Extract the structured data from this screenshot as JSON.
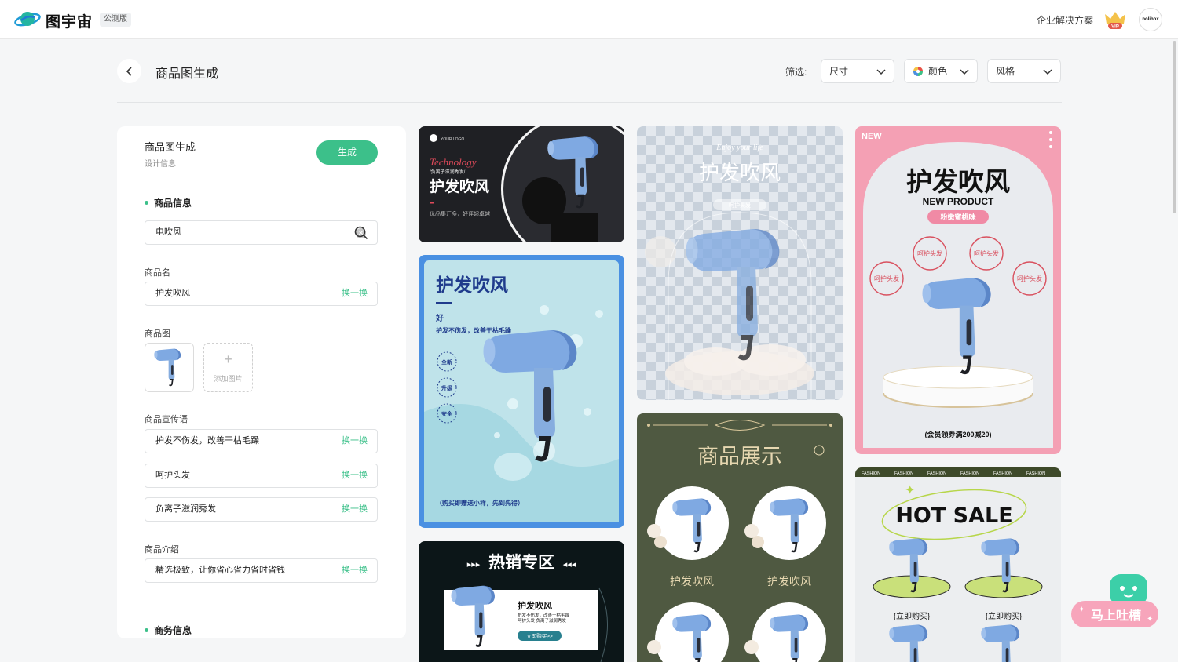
{
  "brand": {
    "name": "图宇宙",
    "badge": "公测版"
  },
  "topbar": {
    "enterprise": "企业解决方案",
    "vip": "VIP",
    "avatar_text": "nolibox"
  },
  "header": {
    "title": "商品图生成",
    "filter_label": "筛选:",
    "filters": [
      "尺寸",
      "颜色",
      "风格"
    ]
  },
  "panel": {
    "title": "商品图生成",
    "subtitle": "设计信息",
    "generate": "生成",
    "product_info": "商品信息",
    "search_value": "电吹风",
    "name_label": "商品名",
    "name_value": "护发吹风",
    "image_label": "商品图",
    "add_image": "添加图片",
    "slogan_label": "商品宣传语",
    "slogans": [
      "护发不伤发，改善干枯毛躁",
      "呵护头发",
      "负离子滋润秀发"
    ],
    "intro_label": "商品介绍",
    "intro_value": "精选极致，让你省心省力省时省钱",
    "swap": "换一换",
    "business_info": "商务信息"
  },
  "templates": {
    "t1": {
      "logo": "YOUR LOGO",
      "script": "Technology",
      "tag": "/负离子滋润秀发/",
      "title": "护发吹风",
      "caption": "优品集汇多，好评超卓越"
    },
    "t2": {
      "title": "护发吹风",
      "good": "好",
      "sub": "护发不伤发，改善干枯毛躁",
      "badges": [
        "全新",
        "升级",
        "安全"
      ],
      "footer": "（购买即赠送小样，先到先得）"
    },
    "t3": {
      "script": "Enjoy your life",
      "title": "护发吹风",
      "pill": "呵护头发"
    },
    "t4": {
      "new": "NEW",
      "title": "护发吹风",
      "sub": "NEW PRODUCT",
      "pill": "粉嫩蜜桃味",
      "stamps": [
        "呵护头发",
        "呵护头发",
        "呵护头发",
        "呵护头发"
      ],
      "footer": "(会员领券满200减20)"
    },
    "t5": {
      "title": "商品展示",
      "items": [
        "护发吹风",
        "护发吹风"
      ]
    },
    "t6": {
      "title": "热销专区",
      "name": "护发吹风",
      "line1": "护发不伤发，改善干枯毛躁",
      "line2": "呵护头发  负离子滋润秀发",
      "cta": "立即购买>>"
    },
    "t7": {
      "strip": [
        "FASHION",
        "FASHION",
        "FASHION",
        "FASHION",
        "FASHION",
        "FASHION"
      ],
      "title": "HOT SALE",
      "buy": [
        "{立即购买}",
        "{立即购买}"
      ]
    }
  },
  "feedback": {
    "label": "马上吐槽"
  },
  "colors": {
    "accent": "#3cc08a",
    "pink": "#f4a0b4",
    "blue": "#4a90e2"
  },
  "icons": [
    "back-arrow-icon",
    "chevron-down-icon",
    "color-wheel-icon",
    "search-icon",
    "clear-icon",
    "plus-icon",
    "hair-dryer-icon",
    "crown-icon",
    "mascot-icon"
  ]
}
